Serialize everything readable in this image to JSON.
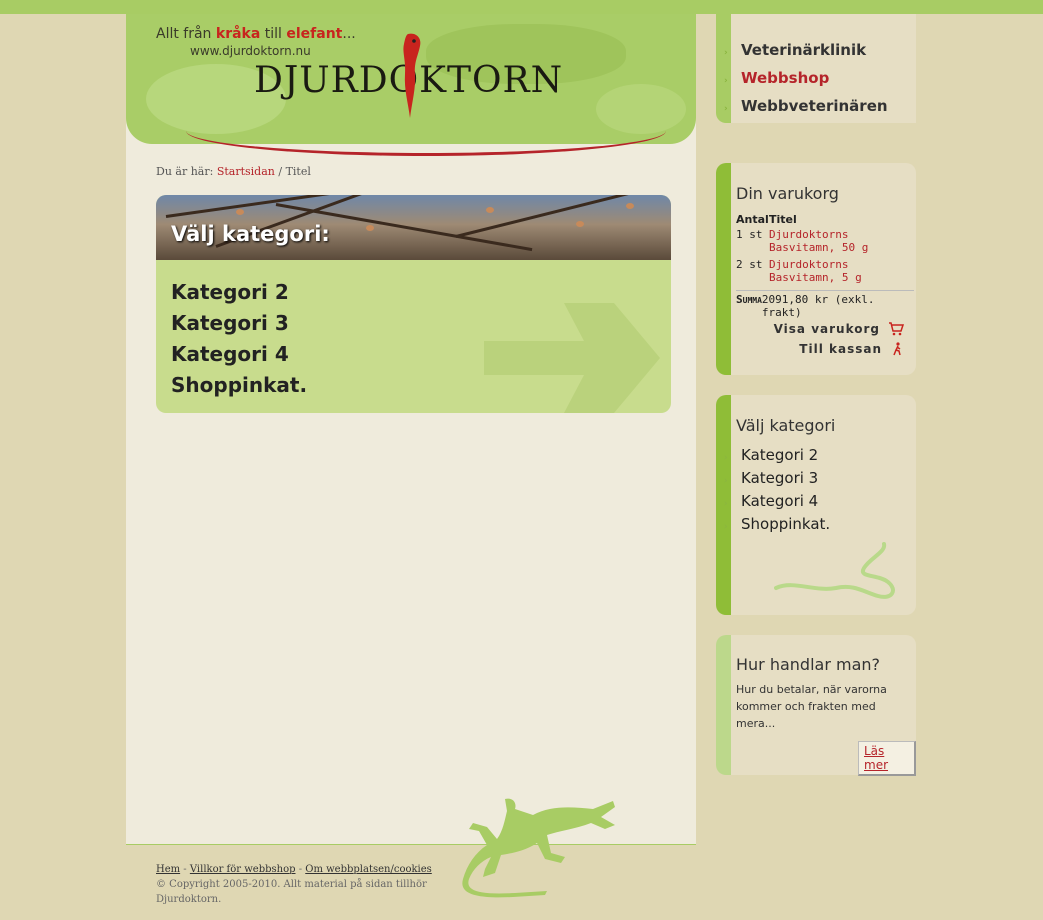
{
  "header": {
    "slogan_pre": "Allt från ",
    "slogan_r1": "kråka",
    "slogan_mid": " till ",
    "slogan_r2": "elefant",
    "slogan_post": "...",
    "url": "www.djurdoktorn.nu",
    "logo": "DJURDOKTORN"
  },
  "breadcrumb": {
    "prefix": "Du är här: ",
    "home": "Startsidan",
    "separator": " / ",
    "current": "Titel"
  },
  "category_box": {
    "title": "Välj kategori:",
    "items": [
      "Kategori 2",
      "Kategori 3",
      "Kategori 4",
      "Shoppinkat."
    ]
  },
  "nav": {
    "items": [
      {
        "label": "Veterinärklinik",
        "active": false
      },
      {
        "label": "Webbshop",
        "active": true
      },
      {
        "label": "Webbveterinären",
        "active": false
      }
    ]
  },
  "cart": {
    "title": "Din varukorg",
    "col_qty": "Antal",
    "col_title": "Titel",
    "rows": [
      {
        "qty": "1 st",
        "title": "Djurdoktorns Basvitamn, 50 g"
      },
      {
        "qty": "2 st",
        "title": "Djurdoktorns Basvitamn, 5 g"
      }
    ],
    "sum_label": "Summa",
    "sum_value": "2091,80 kr (exkl. frakt)",
    "view_cart": "Visa varukorg",
    "checkout": "Till kassan"
  },
  "side_categories": {
    "title": "Välj kategori",
    "items": [
      "Kategori 2",
      "Kategori 3",
      "Kategori 4",
      "Shoppinkat."
    ]
  },
  "how": {
    "title": "Hur handlar man?",
    "text": "Hur du betalar, när varorna kommer och frakten med mera...",
    "more": "Läs mer"
  },
  "footer": {
    "links": [
      "Hem",
      "Villkor för webbshop",
      "Om webbplatsen/cookies"
    ],
    "sep": " - ",
    "copyright": "© Copyright 2005-2010. Allt material på sidan tillhör Djurdoktorn."
  },
  "colors": {
    "accent_red": "#b5242a",
    "green": "#a8cc64",
    "background": "#dfd7b3"
  }
}
